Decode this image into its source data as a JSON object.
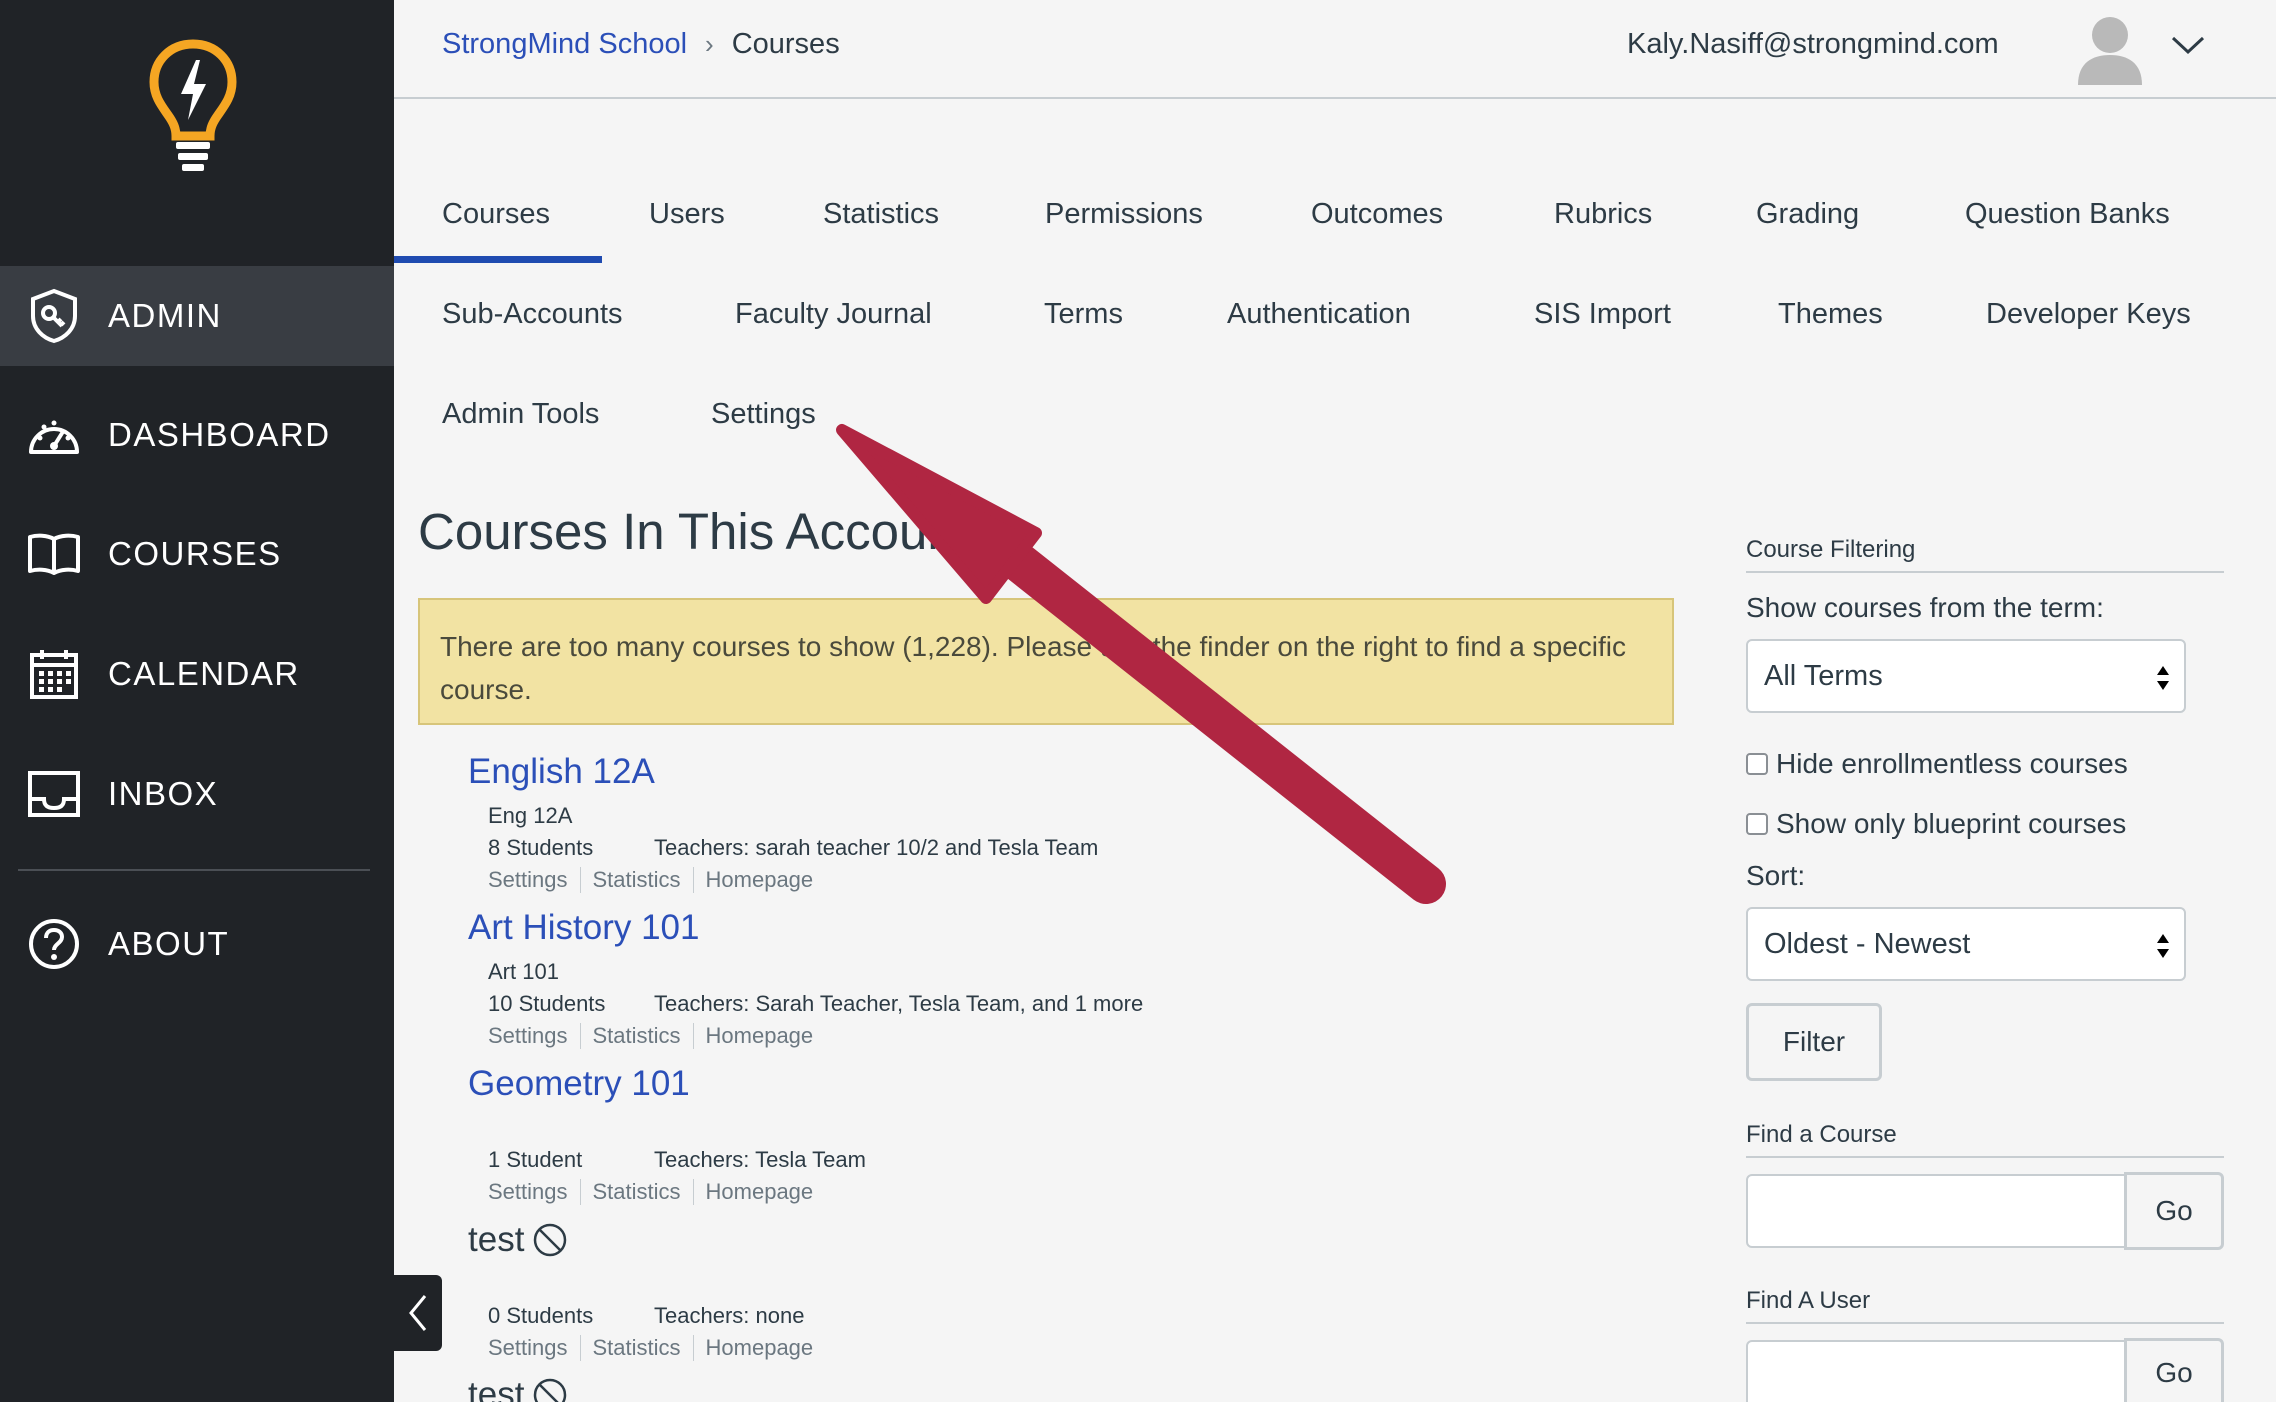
{
  "sidebar": {
    "logo_icon": "lightbulb-bolt-icon",
    "items": [
      {
        "label": "ADMIN",
        "icon": "shield-key-icon"
      },
      {
        "label": "DASHBOARD",
        "icon": "speedometer-icon"
      },
      {
        "label": "COURSES",
        "icon": "book-icon"
      },
      {
        "label": "CALENDAR",
        "icon": "calendar-icon"
      },
      {
        "label": "INBOX",
        "icon": "inbox-tray-icon"
      },
      {
        "label": "ABOUT",
        "icon": "question-circle-icon"
      }
    ],
    "active": "ADMIN"
  },
  "header": {
    "breadcrumb": {
      "root": "StrongMind School",
      "current": "Courses"
    },
    "user_email": "Kaly.Nasiff@strongmind.com"
  },
  "tabs": {
    "row1": [
      "Courses",
      "Users",
      "Statistics",
      "Permissions",
      "Outcomes",
      "Rubrics",
      "Grading",
      "Question Banks"
    ],
    "row2": [
      "Sub-Accounts",
      "Faculty Journal",
      "Terms",
      "Authentication",
      "SIS Import",
      "Themes",
      "Developer Keys"
    ],
    "row3": [
      "Admin Tools",
      "Settings"
    ],
    "active": "Courses"
  },
  "main": {
    "title": "Courses In This Account",
    "alert": "There are too many courses to show (1,228). Please use the finder on the right to find a specific course.",
    "courses": [
      {
        "name": "English 12A",
        "code": "Eng 12A",
        "students": "8 Students",
        "teachers": "Teachers: sarah teacher 10/2 and Tesla Team",
        "links": [
          "Settings",
          "Statistics",
          "Homepage"
        ]
      },
      {
        "name": "Art History 101",
        "code": "Art 101",
        "students": "10 Students",
        "teachers": "Teachers: Sarah Teacher, Tesla Team, and 1 more",
        "links": [
          "Settings",
          "Statistics",
          "Homepage"
        ]
      },
      {
        "name": "Geometry 101",
        "code": "",
        "students": "1 Student",
        "teachers": "Teachers: Tesla Team",
        "links": [
          "Settings",
          "Statistics",
          "Homepage"
        ]
      },
      {
        "name": "test",
        "code": "",
        "students": "0 Students",
        "teachers": "Teachers: none",
        "links": [
          "Settings",
          "Statistics",
          "Homepage"
        ]
      },
      {
        "name": "test",
        "code": "",
        "students": "",
        "teachers": "",
        "links": []
      }
    ]
  },
  "filter_panel": {
    "heading": "Course Filtering",
    "term_label": "Show courses from the term:",
    "term_value": "All Terms",
    "hide_enrollmentless": "Hide enrollmentless courses",
    "show_blueprint": "Show only blueprint courses",
    "sort_label": "Sort:",
    "sort_value": "Oldest - Newest",
    "filter_button": "Filter",
    "find_course_label": "Find a Course",
    "find_user_label": "Find A User",
    "go_label": "Go"
  },
  "colors": {
    "sidebar_bg": "#202327",
    "sidebar_active": "#393d43",
    "link_blue": "#2b4fb8",
    "tab_underline": "#1f4bb0",
    "alert_bg": "#f2e3a3",
    "annotation_arrow": "#b02642",
    "logo_yellow": "#f5a623"
  }
}
